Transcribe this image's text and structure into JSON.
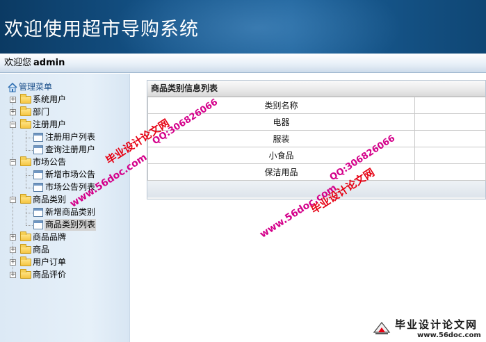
{
  "header": {
    "title": "欢迎使用超市导购系统"
  },
  "welcome": {
    "greeting": "欢迎您",
    "username": "admin"
  },
  "sidebar": {
    "root": "管理菜单",
    "items": [
      {
        "label": "系统用户"
      },
      {
        "label": "部门"
      },
      {
        "label": "注册用户"
      },
      {
        "label": "注册用户列表"
      },
      {
        "label": "查询注册用户"
      },
      {
        "label": "市场公告"
      },
      {
        "label": "新增市场公告"
      },
      {
        "label": "市场公告列表"
      },
      {
        "label": "商品类别"
      },
      {
        "label": "新增商品类别"
      },
      {
        "label": "商品类别列表"
      },
      {
        "label": "商品品牌"
      },
      {
        "label": "商品"
      },
      {
        "label": "用户订单"
      },
      {
        "label": "商品评价"
      }
    ]
  },
  "panel": {
    "title": "商品类别信息列表",
    "header": "类别名称",
    "rows": [
      "电器",
      "服装",
      "小食品",
      "保洁用品"
    ]
  },
  "watermarks": {
    "site_name": "毕业设计论文网",
    "qq": "QQ:306826066",
    "url": "www.56doc.com"
  },
  "footer_logo": {
    "name": "毕业设计论文网",
    "url": "www.56doc.com"
  },
  "colors": {
    "header_bg": "#155489",
    "watermark_red": "#e60012",
    "watermark_magenta": "#d4008a"
  }
}
